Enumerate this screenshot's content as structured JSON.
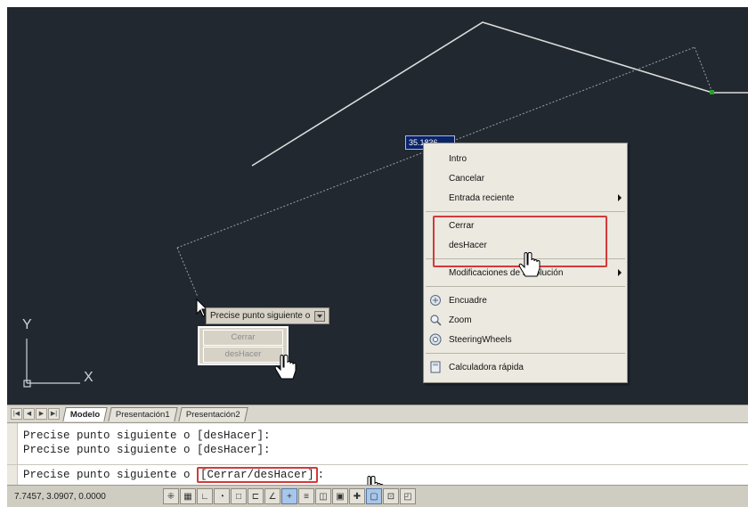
{
  "drawing": {
    "ucs_y_label": "Y",
    "ucs_x_label": "X"
  },
  "coord_input": {
    "value": "35.1836"
  },
  "dynamic_input": {
    "prompt": "Precise punto siguiente o",
    "options": [
      "Cerrar",
      "desHacer"
    ]
  },
  "context_menu": {
    "items": [
      {
        "label": "Intro",
        "underline": "I",
        "rest": "ntro"
      },
      {
        "label": "Cancelar",
        "underline": "C",
        "rest": "ancelar"
      },
      {
        "label": "Entrada reciente",
        "has_submenu": true
      },
      {
        "label": "Cerrar"
      },
      {
        "label": "desHacer"
      },
      {
        "label": "Modificaciones de resolución",
        "has_submenu": true
      },
      {
        "label": "Encuadre",
        "icon": "pan-icon",
        "underline": "E",
        "rest": "ncuadre"
      },
      {
        "label": "Zoom",
        "icon": "zoom-icon",
        "underline": "Z",
        "rest": "oom"
      },
      {
        "label": "SteeringWheels",
        "icon": "steering-wheels-icon"
      },
      {
        "label": "Calculadora rápida",
        "icon": "calculator-icon"
      }
    ]
  },
  "tabs": {
    "items": [
      "Modelo",
      "Presentación1",
      "Presentación2"
    ],
    "active": "Modelo"
  },
  "command_window": {
    "history": [
      "Precise punto siguiente o [desHacer]:",
      "Precise punto siguiente o [desHacer]:"
    ],
    "current_prefix": "Precise punto siguiente o ",
    "current_options": "[Cerrar/desHacer]",
    "current_suffix": ":"
  },
  "status_bar": {
    "coordinates": "7.7457, 3.0907, 0.0000"
  },
  "colors": {
    "canvas_bg": "#212830",
    "highlight_red": "#d23a3a",
    "menu_bg": "#ece9e0"
  }
}
